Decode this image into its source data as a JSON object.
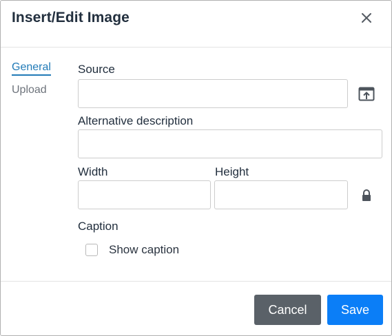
{
  "dialog": {
    "title": "Insert/Edit Image",
    "close_icon": "close-icon"
  },
  "tabs": [
    {
      "label": "General",
      "active": true
    },
    {
      "label": "Upload",
      "active": false
    }
  ],
  "form": {
    "source_label": "Source",
    "source_value": "",
    "browse_icon": "upload-browse-icon",
    "alt_label": "Alternative description",
    "alt_value": "",
    "width_label": "Width",
    "width_value": "",
    "height_label": "Height",
    "height_value": "",
    "lock_icon": "lock-icon",
    "caption_label": "Caption",
    "show_caption_label": "Show caption",
    "show_caption_checked": false
  },
  "footer": {
    "cancel_label": "Cancel",
    "save_label": "Save"
  },
  "colors": {
    "accent": "#207ab7",
    "save": "#0b7ef7",
    "cancel": "#5a6168",
    "text": "#222f3e"
  }
}
